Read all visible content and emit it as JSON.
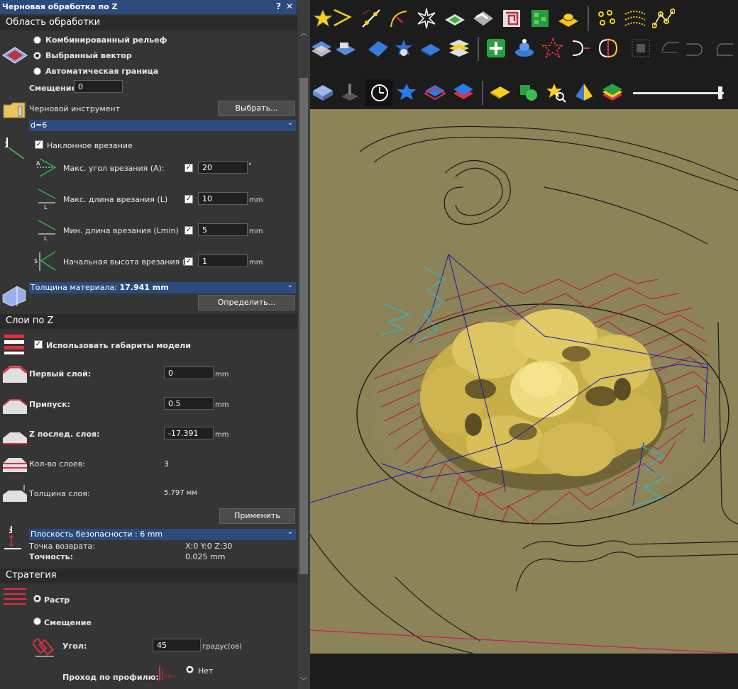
{
  "panel": {
    "title": "Черновая обработка по Z",
    "help": "?",
    "close": "✕",
    "area_section": "Область обработки",
    "area_options": [
      "Комбинированный рельеф",
      "Выбранный вектор",
      "Автоматическая граница"
    ],
    "area_selected": 1,
    "offset_label": "Смещение",
    "offset_value": "0",
    "tool_label": "Черновой инструмент",
    "tool_button": "Выбрать...",
    "tool_value": "d=6",
    "ramp_label": "Наклонное врезание",
    "ramp_rows": [
      {
        "label": "Макс. угол врезания  (A):",
        "value": "20",
        "unit": "°"
      },
      {
        "label": "Макс. длина врезания (L)",
        "value": "10",
        "unit": "mm"
      },
      {
        "label": "Мин. длина врезания (Lmin)",
        "value": "5",
        "unit": "mm"
      },
      {
        "label": "Начальная высота врезания (S)",
        "value": "1",
        "unit": "mm"
      }
    ],
    "material_label": "Толщина материала:",
    "material_value": "17.941 mm",
    "define_button": "Определить...",
    "layers_section": "Слои по Z",
    "use_bounds_label": "Использовать габариты модели",
    "first_layer_label": "Первый слой:",
    "first_layer_value": "0",
    "allowance_label": "Припуск:",
    "allowance_value": "0.5",
    "last_layer_label": "Z послед. слоя:",
    "last_layer_value": "-17.391",
    "unit_mm": "mm",
    "layer_count_label": "Кол-во слоев:",
    "layer_count_value": "3",
    "layer_thickness_label": "Толщина слоя:",
    "layer_thickness_value": "5.797 мм",
    "apply_button": "Применить",
    "safety_label": "Плоскость безопасности : 6 mm",
    "return_label": "Точка возврата:",
    "return_value": "X:0 Y:0 Z:30",
    "accuracy_label": "Точность:",
    "accuracy_value": "0.025 mm",
    "strategy_section": "Стратегия",
    "strategy_options": [
      "Растр",
      "Смещение"
    ],
    "strategy_selected": 0,
    "angle_label": "Угол:",
    "angle_value": "45",
    "angle_unit": "градус(ов)",
    "profile_label": "Проход по профилю:",
    "profile_option": "Нет"
  },
  "toolbar_icons": {
    "row1": [
      "star-select-icon",
      "bezier-arrow-icon",
      "node-edit-icon",
      "curve-icon",
      "star-shape-icon",
      "emboss-icon",
      "weave-icon",
      "tiles-icon",
      "texture-icon",
      "relief-icon",
      "points-icon",
      "dotted-lines-icon",
      "polyline-icon"
    ],
    "row2": [
      "reliefs-stack-icon",
      "extrude-icon",
      "surface-icon",
      "star-relief-icon",
      "flat-relief-icon",
      "layers-icon",
      "add-icon",
      "spin-icon",
      "star-fill-icon",
      "mirror-icon",
      "half-circle-icon",
      "grid-icon",
      "dim-1-icon",
      "dim-2-icon",
      "dim-3-icon"
    ],
    "row3": [
      "box-view-icon",
      "tool-view-icon",
      "clock-icon",
      "star-blue-icon",
      "layers-blue-icon",
      "layers-red-icon",
      "diamond-icon",
      "shapes-icon",
      "star-zoom-icon",
      "multicolor-icon",
      "rainbow-icon"
    ]
  },
  "colors": {
    "title_bar": "#2d4a7c",
    "viewport_bg": "#8c8358",
    "toolpath_red": "#c0142a",
    "toolpath_blue": "#1a1aaa",
    "toolpath_cyan": "#2ab8d8",
    "relief": "#e0c860"
  }
}
